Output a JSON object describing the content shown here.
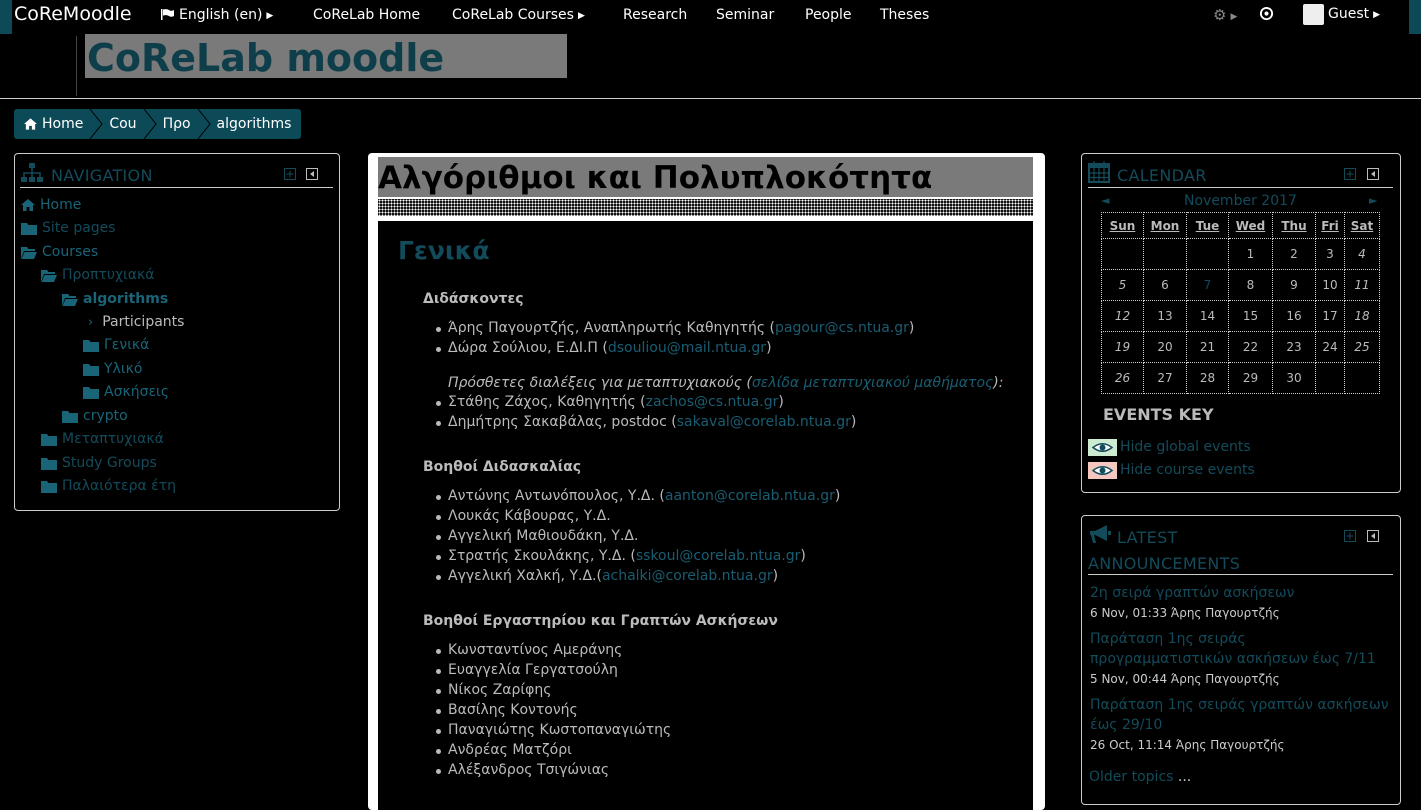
{
  "topbar": {
    "brand": "CoReMoodle",
    "language": "English (en)",
    "items": [
      "CoReLab Home",
      "CoReLab Courses",
      "Research",
      "Seminar",
      "People",
      "Theses"
    ],
    "guest": "Guest"
  },
  "header": {
    "site_title": "CoReLab moodle"
  },
  "breadcrumb": [
    "Home",
    "Cou",
    "Προ",
    "algorithms"
  ],
  "navigation": {
    "title": "NAVIGATION",
    "home": "Home",
    "site_pages": "Site pages",
    "courses": "Courses",
    "undergrad": "Προπτυχιακά",
    "algorithms": "algorithms",
    "participants": "Participants",
    "general": "Γενικά",
    "material": "Υλικό",
    "exercises": "Ασκήσεις",
    "crypto": "crypto",
    "postgrad": "Μεταπτυχιακά",
    "study_groups": "Study Groups",
    "older_years": "Παλαιότερα έτη"
  },
  "course": {
    "title": "Αλγόριθμοι και Πολυπλοκότητα",
    "section": "Γενικά",
    "instructors_heading": "Διδάσκοντες",
    "instructors": [
      {
        "name": "Άρης Παγουρτζής, Αναπληρωτής Καθηγητής (",
        "email": "pagour@cs.ntua.gr",
        "close": ")"
      },
      {
        "name": "Δώρα Σούλιου, Ε.ΔΙ.Π (",
        "email": "dsouliou@mail.ntua.gr",
        "close": ")"
      }
    ],
    "extra_note_pre": "Πρόσθετες διαλέξεις για μεταπτυχιακούς (",
    "extra_note_link": "σελίδα μεταπτυχιακού μαθήματος",
    "extra_note_post": "):",
    "extra": [
      {
        "name": "Στάθης Ζάχος, Καθηγητής (",
        "email": "zachos@cs.ntua.gr",
        "close": ")"
      },
      {
        "name": "Δημήτρης Σακαβάλας, postdoc (",
        "email": "sakaval@corelab.ntua.gr",
        "close": ")"
      }
    ],
    "ta_heading": "Βοηθοί Διδασκαλίας",
    "tas": [
      {
        "name": "Αντώνης Αντωνόπουλος, Υ.Δ. (",
        "email": "aanton@corelab.ntua.gr",
        "close": ")"
      },
      {
        "name": "Λουκάς Κάβουρας, Υ.Δ.",
        "email": "",
        "close": ""
      },
      {
        "name": "Αγγελική Μαθιουδάκη, Υ.Δ.",
        "email": "",
        "close": ""
      },
      {
        "name": "Στρατής Σκουλάκης, Υ.Δ. (",
        "email": "sskoul@corelab.ntua.gr",
        "close": ")"
      },
      {
        "name": "Αγγελική Χαλκή, Υ.Δ.(",
        "email": "achalki@corelab.ntua.gr",
        "close": ")"
      }
    ],
    "lab_heading": "Βοηθοί Εργαστηρίου και Γραπτών Ασκήσεων",
    "lab": [
      "Κωνσταντίνος Αμεράνης",
      "Ευαγγελία Γεργατσούλη",
      "Νίκος Ζαρίφης",
      "Βασίλης Κοντονής",
      "Παναγιώτης Κωστοπαναγιώτης",
      "Ανδρέας Ματζόρι",
      "Αλέξανδρος Τσιγώνιας"
    ]
  },
  "calendar": {
    "title": "CALENDAR",
    "month": "November 2017",
    "weekdays": [
      "Sun",
      "Mon",
      "Tue",
      "Wed",
      "Thu",
      "Fri",
      "Sat"
    ],
    "weeks": [
      [
        "",
        "",
        "",
        "1",
        "2",
        "3",
        "4"
      ],
      [
        "5",
        "6",
        "7",
        "8",
        "9",
        "10",
        "11"
      ],
      [
        "12",
        "13",
        "14",
        "15",
        "16",
        "17",
        "18"
      ],
      [
        "19",
        "20",
        "21",
        "22",
        "23",
        "24",
        "25"
      ],
      [
        "26",
        "27",
        "28",
        "29",
        "30",
        "",
        ""
      ]
    ],
    "today": "7",
    "events_key": "EVENTS KEY",
    "hide_global": "Hide global events",
    "hide_course": "Hide course events",
    "global_color": "#cdebd0",
    "course_color": "#f4c7bf"
  },
  "announcements": {
    "title_line1": "LATEST",
    "title_line2": "ANNOUNCEMENTS",
    "items": [
      {
        "title": "2η σειρά γραπτών ασκήσεων",
        "meta": "6 Nov, 01:33  Άρης Παγουρτζής"
      },
      {
        "title": "Παράταση 1ης σειράς προγραμματιστικών ασκήσεων έως 7/11",
        "meta": "5 Nov, 00:44  Άρης Παγουρτζής"
      },
      {
        "title": "Παράταση 1ης σειράς γραπτών ασκήσεων έως 29/10",
        "meta": "26 Oct, 11:14  Άρης Παγουρτζής"
      }
    ],
    "older": "Older topics",
    "ellipsis": "..."
  },
  "colors": {
    "accent": "#0d4a58",
    "link": "#134b5b"
  }
}
